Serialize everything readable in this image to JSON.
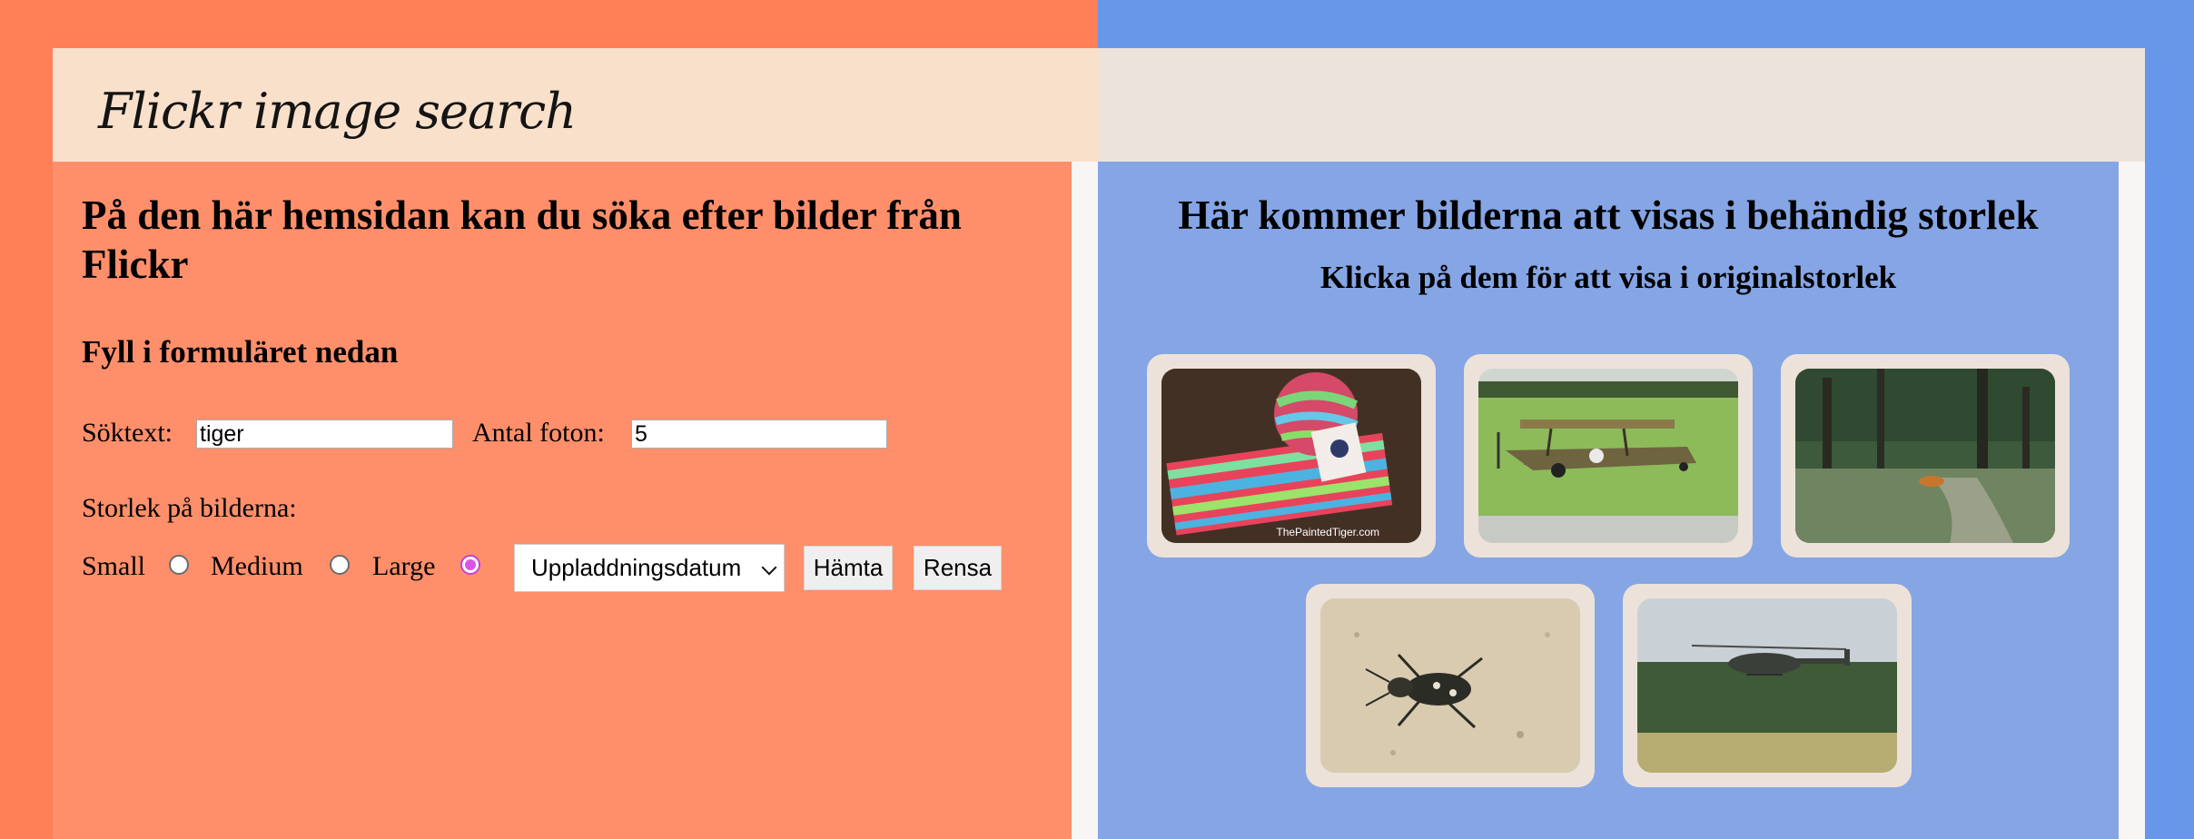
{
  "header": {
    "title": "Flickr image search"
  },
  "left": {
    "intro_heading": "På den här hemsidan kan du söka efter bilder från Flickr",
    "form_heading": "Fyll i formuläret nedan",
    "search_label": "Söktext:",
    "search_value": "tiger",
    "count_label": "Antal foton:",
    "count_value": "5",
    "size_label": "Storlek på bilderna:",
    "sizes": [
      {
        "label": "Small",
        "checked": false
      },
      {
        "label": "Medium",
        "checked": false
      },
      {
        "label": "Large",
        "checked": true
      }
    ],
    "sort_selected": "Uppladdningsdatum",
    "fetch_button": "Hämta",
    "clear_button": "Rensa"
  },
  "right": {
    "heading": "Här kommer bilderna att visas i behändig storlek",
    "subheading": "Klicka på dem för att visa i originalstorlek",
    "photos": [
      {
        "subject": "knitted-sock-and-yarn",
        "caption": "ThePaintedTiger.com"
      },
      {
        "subject": "tiger-moth-biplane"
      },
      {
        "subject": "tiger-in-forest"
      },
      {
        "subject": "tiger-beetle-on-sand"
      },
      {
        "subject": "tiger-helicopter"
      }
    ]
  },
  "colors": {
    "left_background": "#ff7f57",
    "right_background": "#6897e9",
    "left_panel": "#ff8f6b",
    "right_panel": "#85a5e5",
    "card": "#ede2d9",
    "radio_accent": "#d952ea"
  }
}
